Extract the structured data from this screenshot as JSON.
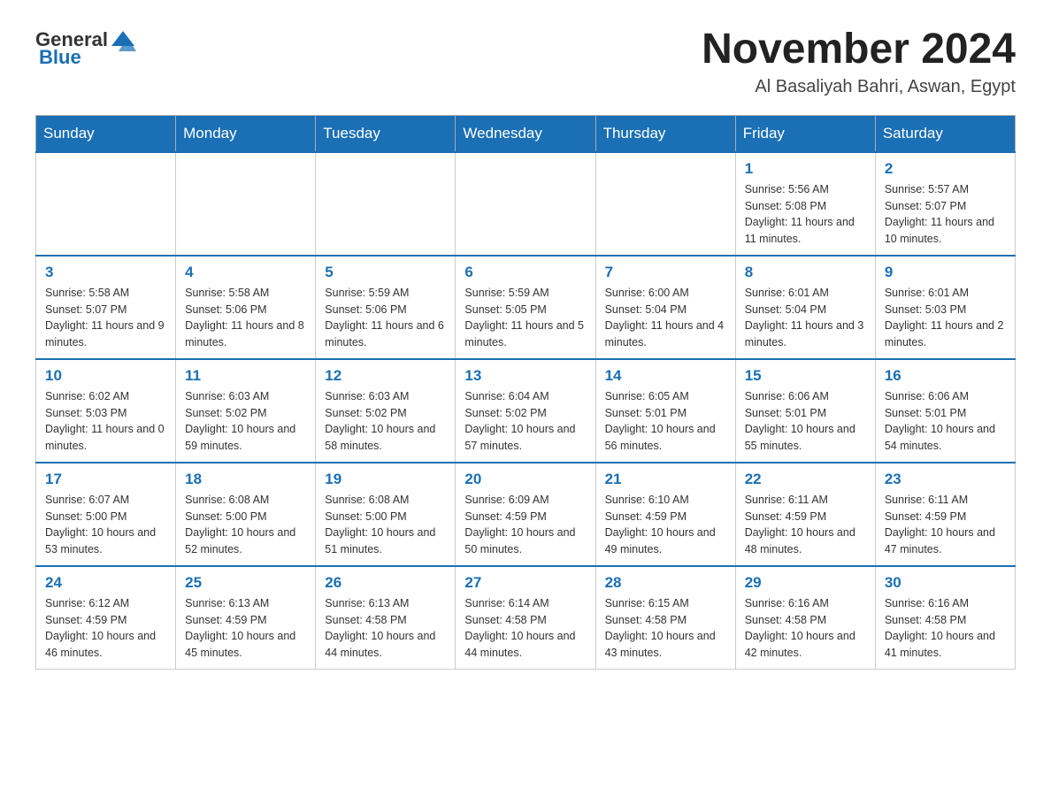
{
  "header": {
    "logo_general": "General",
    "logo_blue": "Blue",
    "month_title": "November 2024",
    "subtitle": "Al Basaliyah Bahri, Aswan, Egypt"
  },
  "days_of_week": [
    "Sunday",
    "Monday",
    "Tuesday",
    "Wednesday",
    "Thursday",
    "Friday",
    "Saturday"
  ],
  "weeks": [
    [
      {
        "day": "",
        "info": ""
      },
      {
        "day": "",
        "info": ""
      },
      {
        "day": "",
        "info": ""
      },
      {
        "day": "",
        "info": ""
      },
      {
        "day": "",
        "info": ""
      },
      {
        "day": "1",
        "info": "Sunrise: 5:56 AM\nSunset: 5:08 PM\nDaylight: 11 hours and 11 minutes."
      },
      {
        "day": "2",
        "info": "Sunrise: 5:57 AM\nSunset: 5:07 PM\nDaylight: 11 hours and 10 minutes."
      }
    ],
    [
      {
        "day": "3",
        "info": "Sunrise: 5:58 AM\nSunset: 5:07 PM\nDaylight: 11 hours and 9 minutes."
      },
      {
        "day": "4",
        "info": "Sunrise: 5:58 AM\nSunset: 5:06 PM\nDaylight: 11 hours and 8 minutes."
      },
      {
        "day": "5",
        "info": "Sunrise: 5:59 AM\nSunset: 5:06 PM\nDaylight: 11 hours and 6 minutes."
      },
      {
        "day": "6",
        "info": "Sunrise: 5:59 AM\nSunset: 5:05 PM\nDaylight: 11 hours and 5 minutes."
      },
      {
        "day": "7",
        "info": "Sunrise: 6:00 AM\nSunset: 5:04 PM\nDaylight: 11 hours and 4 minutes."
      },
      {
        "day": "8",
        "info": "Sunrise: 6:01 AM\nSunset: 5:04 PM\nDaylight: 11 hours and 3 minutes."
      },
      {
        "day": "9",
        "info": "Sunrise: 6:01 AM\nSunset: 5:03 PM\nDaylight: 11 hours and 2 minutes."
      }
    ],
    [
      {
        "day": "10",
        "info": "Sunrise: 6:02 AM\nSunset: 5:03 PM\nDaylight: 11 hours and 0 minutes."
      },
      {
        "day": "11",
        "info": "Sunrise: 6:03 AM\nSunset: 5:02 PM\nDaylight: 10 hours and 59 minutes."
      },
      {
        "day": "12",
        "info": "Sunrise: 6:03 AM\nSunset: 5:02 PM\nDaylight: 10 hours and 58 minutes."
      },
      {
        "day": "13",
        "info": "Sunrise: 6:04 AM\nSunset: 5:02 PM\nDaylight: 10 hours and 57 minutes."
      },
      {
        "day": "14",
        "info": "Sunrise: 6:05 AM\nSunset: 5:01 PM\nDaylight: 10 hours and 56 minutes."
      },
      {
        "day": "15",
        "info": "Sunrise: 6:06 AM\nSunset: 5:01 PM\nDaylight: 10 hours and 55 minutes."
      },
      {
        "day": "16",
        "info": "Sunrise: 6:06 AM\nSunset: 5:01 PM\nDaylight: 10 hours and 54 minutes."
      }
    ],
    [
      {
        "day": "17",
        "info": "Sunrise: 6:07 AM\nSunset: 5:00 PM\nDaylight: 10 hours and 53 minutes."
      },
      {
        "day": "18",
        "info": "Sunrise: 6:08 AM\nSunset: 5:00 PM\nDaylight: 10 hours and 52 minutes."
      },
      {
        "day": "19",
        "info": "Sunrise: 6:08 AM\nSunset: 5:00 PM\nDaylight: 10 hours and 51 minutes."
      },
      {
        "day": "20",
        "info": "Sunrise: 6:09 AM\nSunset: 4:59 PM\nDaylight: 10 hours and 50 minutes."
      },
      {
        "day": "21",
        "info": "Sunrise: 6:10 AM\nSunset: 4:59 PM\nDaylight: 10 hours and 49 minutes."
      },
      {
        "day": "22",
        "info": "Sunrise: 6:11 AM\nSunset: 4:59 PM\nDaylight: 10 hours and 48 minutes."
      },
      {
        "day": "23",
        "info": "Sunrise: 6:11 AM\nSunset: 4:59 PM\nDaylight: 10 hours and 47 minutes."
      }
    ],
    [
      {
        "day": "24",
        "info": "Sunrise: 6:12 AM\nSunset: 4:59 PM\nDaylight: 10 hours and 46 minutes."
      },
      {
        "day": "25",
        "info": "Sunrise: 6:13 AM\nSunset: 4:59 PM\nDaylight: 10 hours and 45 minutes."
      },
      {
        "day": "26",
        "info": "Sunrise: 6:13 AM\nSunset: 4:58 PM\nDaylight: 10 hours and 44 minutes."
      },
      {
        "day": "27",
        "info": "Sunrise: 6:14 AM\nSunset: 4:58 PM\nDaylight: 10 hours and 44 minutes."
      },
      {
        "day": "28",
        "info": "Sunrise: 6:15 AM\nSunset: 4:58 PM\nDaylight: 10 hours and 43 minutes."
      },
      {
        "day": "29",
        "info": "Sunrise: 6:16 AM\nSunset: 4:58 PM\nDaylight: 10 hours and 42 minutes."
      },
      {
        "day": "30",
        "info": "Sunrise: 6:16 AM\nSunset: 4:58 PM\nDaylight: 10 hours and 41 minutes."
      }
    ]
  ]
}
